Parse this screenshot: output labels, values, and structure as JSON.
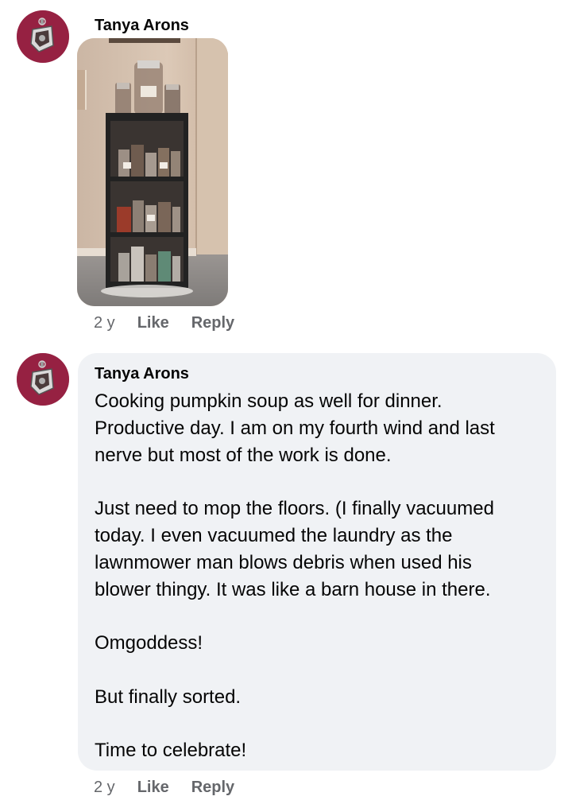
{
  "comments": [
    {
      "author": "Tanya Arons",
      "avatar_icon": "mandala-avatar-icon",
      "attachment_icon": "photo-shelf-jars",
      "time": "2 y",
      "like_label": "Like",
      "reply_label": "Reply"
    },
    {
      "author": "Tanya Arons",
      "avatar_icon": "mandala-avatar-icon",
      "lines": [
        "Cooking pumpkin soup as well for dinner.",
        "Productive day.  I am on my fourth wind and last",
        "nerve but most of the work is done.",
        "Just need to mop the floors.   (I finally vacuumed",
        "today.  I even vacuumed the laundry as the",
        "lawnmower man blows debris when used his",
        "blower thingy.  It was like a barn house in there.",
        "Omgoddess!",
        "But finally sorted.",
        "Time to celebrate!"
      ],
      "time": "2 y",
      "like_label": "Like",
      "reply_label": "Reply"
    }
  ],
  "colors": {
    "bubble_bg": "#f0f2f5",
    "meta_text": "#65676b",
    "avatar_bg": "#8e1d3d"
  }
}
